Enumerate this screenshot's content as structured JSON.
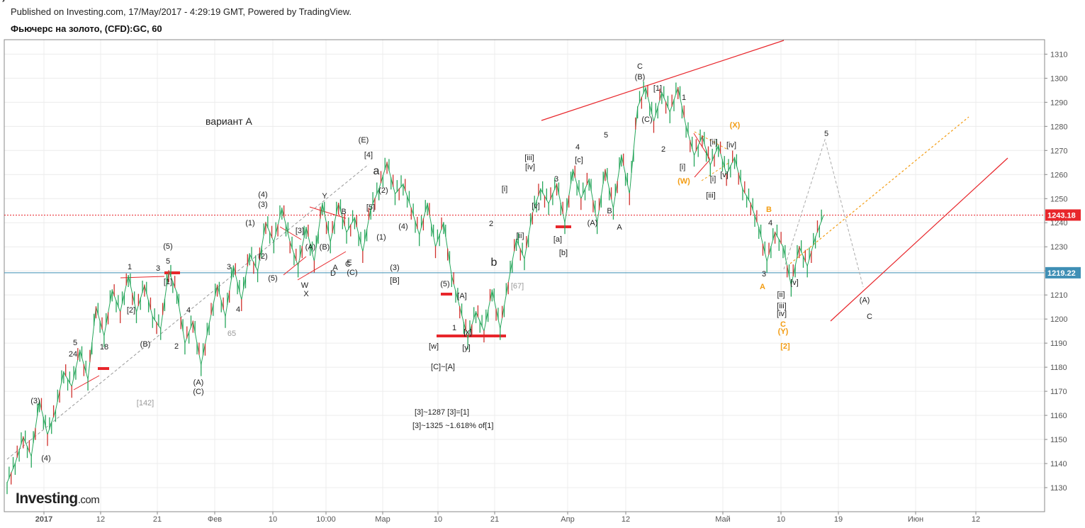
{
  "header": {
    "published": "Published on Investing.com, 17/May/2017 - 4:29:19 GMT, Powered by TradingView.",
    "instrument": "Фьючерс на золото, (CFD):GC, 60"
  },
  "brand": {
    "name": "Investing",
    "suffix": ".com"
  },
  "chart_data": {
    "type": "line",
    "title": "Фьючерс на золото, (CFD):GC, 60",
    "ylim": [
      1120,
      1316
    ],
    "y_ticks": [
      1130,
      1140,
      1150,
      1160,
      1170,
      1180,
      1190,
      1200,
      1210,
      1220,
      1230,
      1240,
      1250,
      1260,
      1270,
      1280,
      1290,
      1300,
      1310
    ],
    "x_labels": [
      "2017",
      "12",
      "21",
      "Фев",
      "10",
      "10:00",
      "Мар",
      "10",
      "21",
      "Апр",
      "12",
      "Май",
      "10",
      "19",
      "Июн",
      "12"
    ],
    "price_markers": [
      {
        "value": 1243.18,
        "label": "1243.18",
        "color": "#e8262b"
      },
      {
        "value": 1219.22,
        "label": "1219.22",
        "color": "#3f8fb5"
      }
    ],
    "series": [
      {
        "values": [
          1132,
          1140,
          1151,
          1143,
          1166,
          1152,
          1162,
          1178,
          1172,
          1187,
          1175,
          1205,
          1193,
          1212,
          1203,
          1218,
          1203,
          1214,
          1201,
          1196,
          1220,
          1211,
          1190,
          1199,
          1181,
          1198,
          1214,
          1201,
          1222,
          1208,
          1227,
          1220,
          1240,
          1232,
          1246,
          1232,
          1222,
          1238,
          1224,
          1248,
          1232,
          1248,
          1236,
          1242,
          1228,
          1246,
          1254,
          1265,
          1252,
          1256,
          1246,
          1235,
          1248,
          1230,
          1240,
          1218,
          1205,
          1192,
          1203,
          1195,
          1212,
          1196,
          1215,
          1233,
          1225,
          1244,
          1254,
          1248,
          1256,
          1240,
          1262,
          1250,
          1258,
          1240,
          1262,
          1246,
          1268,
          1252,
          1288,
          1296,
          1282,
          1294,
          1286,
          1296,
          1280,
          1268,
          1276,
          1264,
          1272,
          1260,
          1267,
          1254,
          1248,
          1238,
          1224,
          1236,
          1230,
          1214,
          1230,
          1222,
          1234,
          1243
        ]
      }
    ],
    "annotations": {
      "variant": "вариант А",
      "notes": [
        "[3]~1287 [3]=[1]",
        "[3]~1325 ~1.618% of[1]"
      ],
      "labels_black": [
        "1",
        "3",
        "5",
        "(5)",
        "[1]",
        "4",
        "(B)",
        "2",
        "(A)",
        "(C)",
        "[2]",
        "18",
        "24",
        "5",
        "(3)",
        "(4)",
        "3",
        "4",
        "(1)",
        "(2)",
        "(3)",
        "(4)",
        "(5)",
        "[3]",
        "W",
        "X",
        "Y",
        "(A)",
        "(B)",
        "A",
        "B",
        "C",
        "D",
        "E",
        "(C)",
        "(E)",
        "[4]",
        "a",
        "[5]",
        "(2)",
        "(1)",
        "(4)",
        "(3)",
        "[B]",
        "(5)",
        "[A]",
        "1",
        "[x]",
        "[w]",
        "[y]",
        "[C]~[A]",
        "2",
        "b",
        "[i]",
        "[ii]",
        "[iii]",
        "[iv]",
        "[v]",
        "3",
        "[a]",
        "[b]",
        "[c]",
        "4",
        "5",
        "(A)",
        "B",
        "A",
        "C",
        "(B)",
        "[1]",
        "(C)",
        "2",
        "1",
        "[i]",
        "[ii]",
        "[iii]",
        "[iv]",
        "[v]",
        "3",
        "4",
        "[i]",
        "[ii]",
        "[iii]",
        "[iv]",
        "[v]",
        "5",
        "(A)",
        "C",
        "(B)",
        "(C)",
        "[2]"
      ],
      "labels_grey": [
        "[142]",
        "65",
        "[67]"
      ],
      "labels_orange": [
        "(X)",
        "(W)",
        "B",
        "A",
        "C",
        "(Y)",
        "[2]"
      ]
    }
  }
}
